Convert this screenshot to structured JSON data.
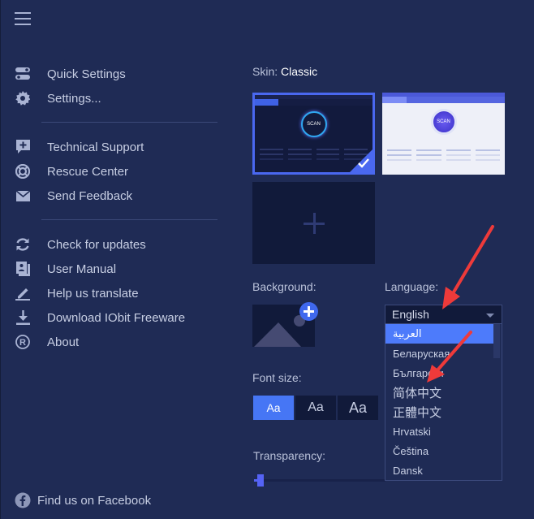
{
  "menu": {
    "hamburger_icon": "hamburger-menu-icon",
    "groups": [
      [
        {
          "label": "Quick Settings",
          "icon": "toggle-switches-icon"
        },
        {
          "label": "Settings...",
          "icon": "gear-icon"
        }
      ],
      [
        {
          "label": "Technical Support",
          "icon": "support-chat-plus-icon"
        },
        {
          "label": "Rescue Center",
          "icon": "lifebuoy-icon"
        },
        {
          "label": "Send Feedback",
          "icon": "envelope-icon"
        }
      ],
      [
        {
          "label": "Check for updates",
          "icon": "refresh-icon"
        },
        {
          "label": "User Manual",
          "icon": "manual-book-icon"
        },
        {
          "label": "Help us translate",
          "icon": "pencil-icon"
        },
        {
          "label": "Download IObit Freeware",
          "icon": "download-icon"
        },
        {
          "label": "About",
          "icon": "registered-icon"
        }
      ]
    ],
    "facebook": {
      "label": "Find us on Facebook",
      "icon": "facebook-icon"
    }
  },
  "skin": {
    "label": "Skin:",
    "value": "Classic",
    "thumbs": [
      {
        "name": "Classic (dark)",
        "selected": true,
        "scan_text": "SCAN"
      },
      {
        "name": "Light",
        "selected": false,
        "scan_text": "SCAN"
      },
      {
        "name": "Custom skin",
        "selected": false
      }
    ]
  },
  "background": {
    "label": "Background:"
  },
  "font_size": {
    "label": "Font size:",
    "options": [
      {
        "label": "Aa",
        "size": "small",
        "active": true
      },
      {
        "label": "Aa",
        "size": "medium",
        "active": false
      },
      {
        "label": "Aa",
        "size": "large",
        "active": false
      }
    ]
  },
  "transparency": {
    "label": "Transparency:",
    "value_percent": 3
  },
  "language": {
    "label": "Language:",
    "selected": "English",
    "options": [
      "العربية",
      "Беларуская",
      "Български",
      "简体中文",
      "正體中文",
      "Hrvatski",
      "Čeština",
      "Dansk"
    ],
    "highlighted_index": 0
  },
  "colors": {
    "background": "#1f2b55",
    "accent": "#4d7bfb",
    "panel_dark": "#111a3a",
    "text": "#c7cee3"
  }
}
